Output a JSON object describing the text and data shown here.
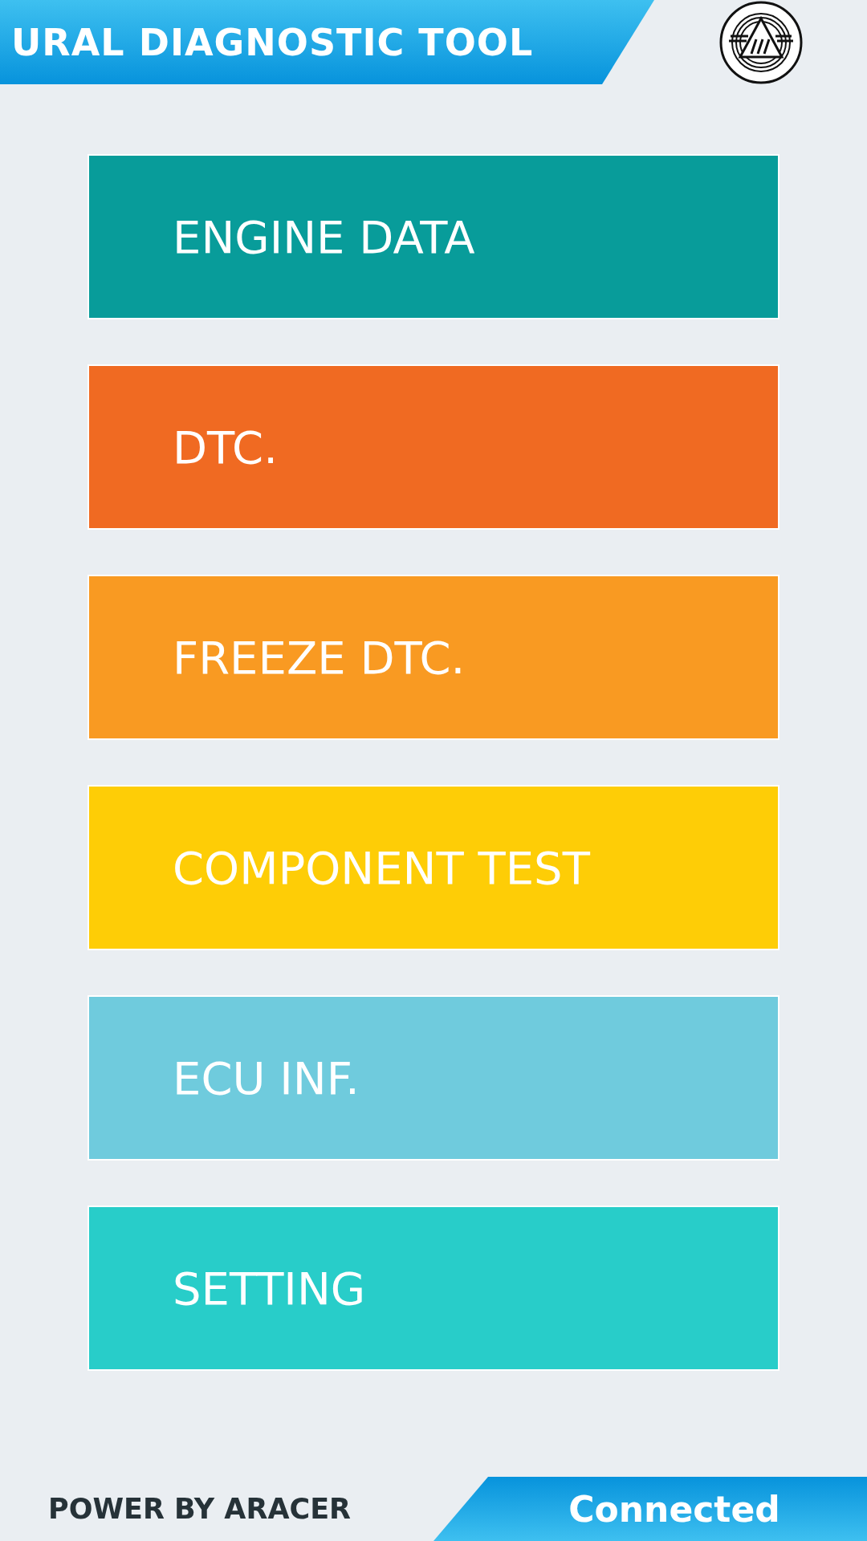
{
  "header": {
    "title": "URAL DIAGNOSTIC TOOL"
  },
  "menu": [
    {
      "label": "ENGINE DATA",
      "color": "#089c9a"
    },
    {
      "label": "DTC.",
      "color": "#f06a22"
    },
    {
      "label": "FREEZE DTC.",
      "color": "#f99a22"
    },
    {
      "label": "COMPONENT TEST",
      "color": "#fecd06"
    },
    {
      "label": "ECU INF.",
      "color": "#6fcbdd"
    },
    {
      "label": "SETTING",
      "color": "#28cdc9"
    }
  ],
  "footer": {
    "credit": "POWER BY ARACER",
    "status": "Connected"
  }
}
